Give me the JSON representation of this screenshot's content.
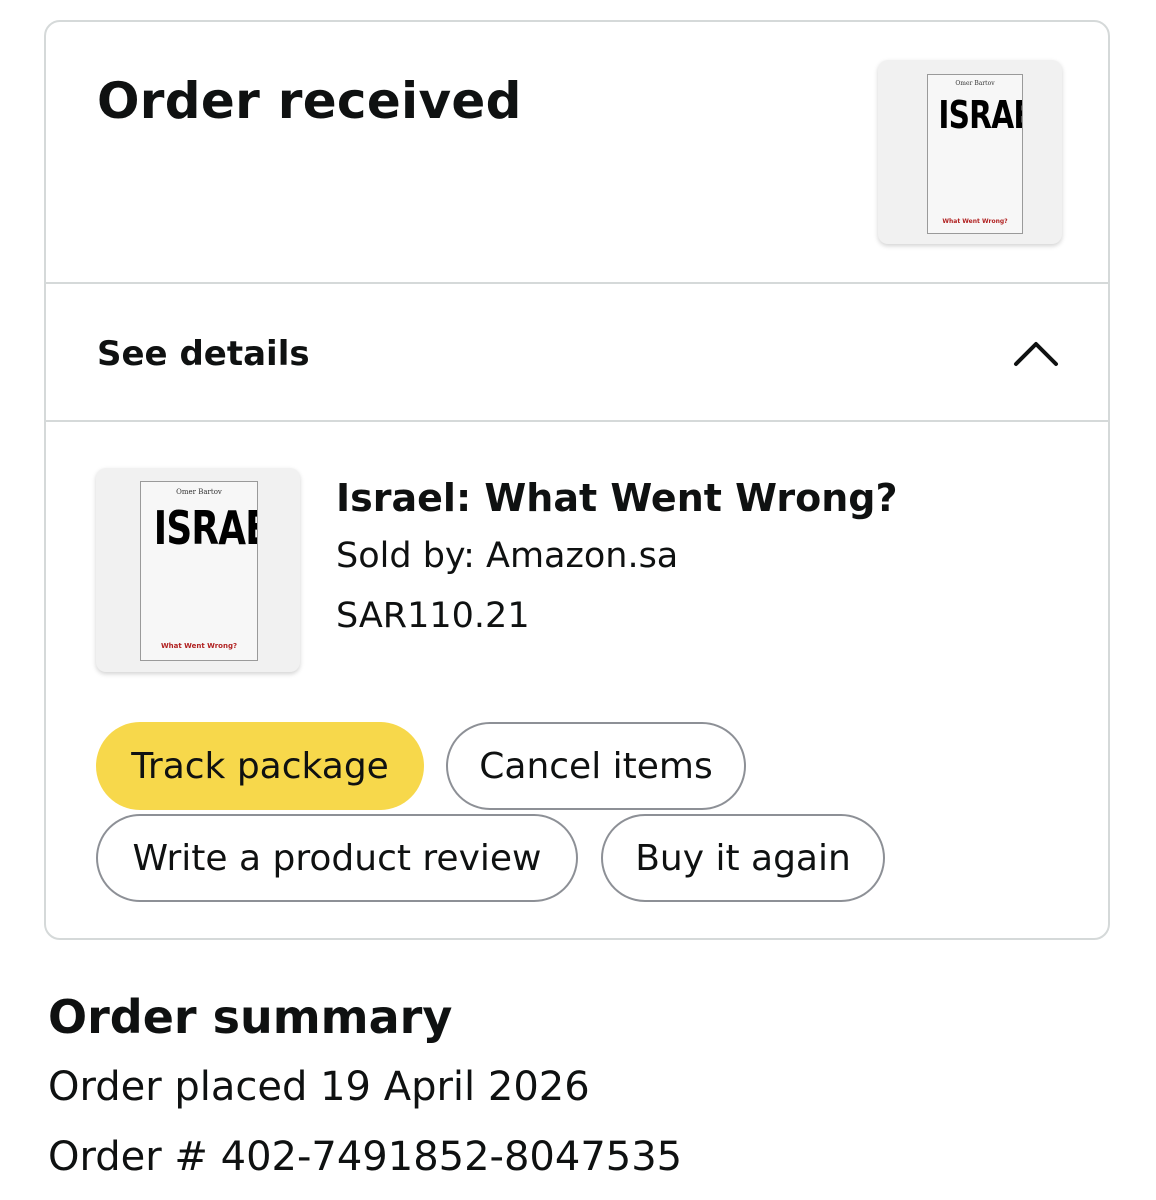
{
  "order_card": {
    "status_title": "Order received",
    "details_label": "See details",
    "details_expanded": true
  },
  "book_cover": {
    "author": "Omer Bartov",
    "title": "ISRAEL",
    "subtitle": "What Went Wrong?"
  },
  "item": {
    "title": "Israel: What Went Wrong?",
    "seller": "Sold by: Amazon.sa",
    "price": "SAR110.21"
  },
  "actions": {
    "track": "Track package",
    "cancel": "Cancel items",
    "review": "Write a product review",
    "buy_again": "Buy it again"
  },
  "summary": {
    "title": "Order summary",
    "placed": "Order placed 19 April 2026",
    "order_number": "Order # 402-7491852-8047535"
  },
  "colors": {
    "primary_button": "#f7d84b",
    "border": "#d5d9d9",
    "text": "#0f1111",
    "cover_subtitle": "#b12222"
  }
}
